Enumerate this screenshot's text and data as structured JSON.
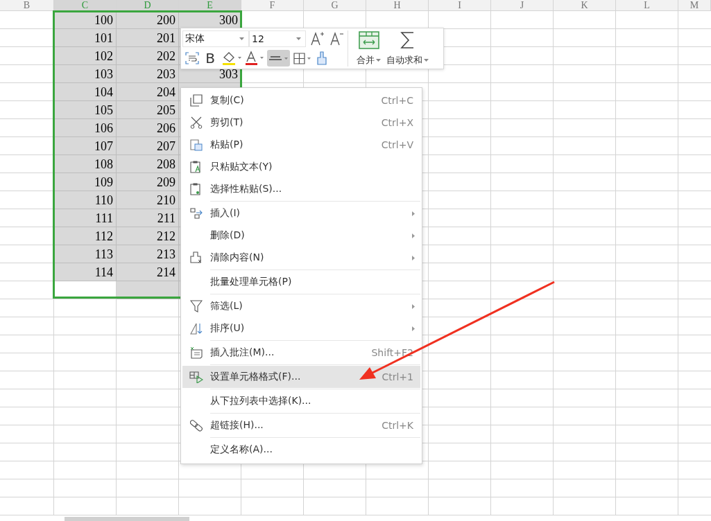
{
  "columns": [
    {
      "label": "B",
      "selected": false
    },
    {
      "label": "C",
      "selected": true
    },
    {
      "label": "D",
      "selected": true
    },
    {
      "label": "E",
      "selected": true
    },
    {
      "label": "F",
      "selected": false
    },
    {
      "label": "G",
      "selected": false
    },
    {
      "label": "H",
      "selected": false
    },
    {
      "label": "I",
      "selected": false
    },
    {
      "label": "J",
      "selected": false
    },
    {
      "label": "K",
      "selected": false
    },
    {
      "label": "L",
      "selected": false
    },
    {
      "label": "M",
      "selected": false
    }
  ],
  "rows": [
    {
      "values": [
        "100",
        "200",
        "300"
      ],
      "selected": [
        true,
        true,
        true
      ]
    },
    {
      "values": [
        "101",
        "201"
      ],
      "selected": [
        true,
        true,
        true
      ]
    },
    {
      "values": [
        "102",
        "202"
      ],
      "selected": [
        true,
        true,
        true
      ]
    },
    {
      "values": [
        "103",
        "203",
        "303"
      ],
      "selected": [
        true,
        true,
        true
      ]
    },
    {
      "values": [
        "104",
        "204"
      ],
      "selected": [
        true,
        true,
        true
      ]
    },
    {
      "values": [
        "105",
        "205"
      ],
      "selected": [
        true,
        true,
        true
      ]
    },
    {
      "values": [
        "106",
        "206"
      ],
      "selected": [
        true,
        true,
        true
      ]
    },
    {
      "values": [
        "107",
        "207"
      ],
      "selected": [
        true,
        true,
        true
      ]
    },
    {
      "values": [
        "108",
        "208"
      ],
      "selected": [
        true,
        true,
        true
      ]
    },
    {
      "values": [
        "109",
        "209"
      ],
      "selected": [
        true,
        true,
        true
      ]
    },
    {
      "values": [
        "110",
        "210"
      ],
      "selected": [
        true,
        true,
        true
      ]
    },
    {
      "values": [
        "111",
        "211"
      ],
      "selected": [
        true,
        true,
        true
      ]
    },
    {
      "values": [
        "112",
        "212"
      ],
      "selected": [
        true,
        true,
        true
      ]
    },
    {
      "values": [
        "113",
        "213"
      ],
      "selected": [
        true,
        true,
        true
      ]
    },
    {
      "values": [
        "114",
        "214"
      ],
      "selected": [
        true,
        true,
        true
      ]
    },
    {
      "selected": [
        false,
        true,
        true
      ]
    }
  ],
  "mini_toolbar": {
    "font": "宋体",
    "size": "12",
    "bold_label": "B",
    "align_selected": true,
    "merge_label": "合并",
    "autosum_label": "自动求和"
  },
  "context_menu": [
    {
      "label": "复制(C)",
      "shortcut": "Ctrl+C",
      "submenu": false,
      "selected": false,
      "divider_after": false
    },
    {
      "label": "剪切(T)",
      "shortcut": "Ctrl+X",
      "submenu": false,
      "selected": false,
      "divider_after": false
    },
    {
      "label": "粘贴(P)",
      "shortcut": "Ctrl+V",
      "submenu": false,
      "selected": false,
      "divider_after": false
    },
    {
      "label": "只粘贴文本(Y)",
      "submenu": false,
      "selected": false,
      "divider_after": false
    },
    {
      "label": "选择性粘贴(S)...",
      "submenu": false,
      "selected": false,
      "divider_after": true
    },
    {
      "label": "插入(I)",
      "submenu": true,
      "selected": false,
      "divider_after": false
    },
    {
      "label": "删除(D)",
      "submenu": true,
      "selected": false,
      "divider_after": false
    },
    {
      "label": "清除内容(N)",
      "submenu": true,
      "selected": false,
      "divider_after": true
    },
    {
      "label": "批量处理单元格(P)",
      "submenu": false,
      "selected": false,
      "divider_after": true
    },
    {
      "label": "筛选(L)",
      "submenu": true,
      "selected": false,
      "divider_after": false
    },
    {
      "label": "排序(U)",
      "submenu": true,
      "selected": false,
      "divider_after": true
    },
    {
      "label": "插入批注(M)...",
      "shortcut": "Shift+F2",
      "submenu": false,
      "selected": false,
      "divider_after": true
    },
    {
      "label": "设置单元格格式(F)...",
      "shortcut": "Ctrl+1",
      "submenu": false,
      "selected": true,
      "divider_after": true
    },
    {
      "label": "从下拉列表中选择(K)...",
      "submenu": false,
      "selected": false,
      "divider_after": true
    },
    {
      "label": "超链接(H)...",
      "shortcut": "Ctrl+K",
      "submenu": false,
      "selected": false,
      "divider_after": true
    },
    {
      "label": "定义名称(A)...",
      "submenu": false,
      "selected": false,
      "divider_after": false
    }
  ]
}
